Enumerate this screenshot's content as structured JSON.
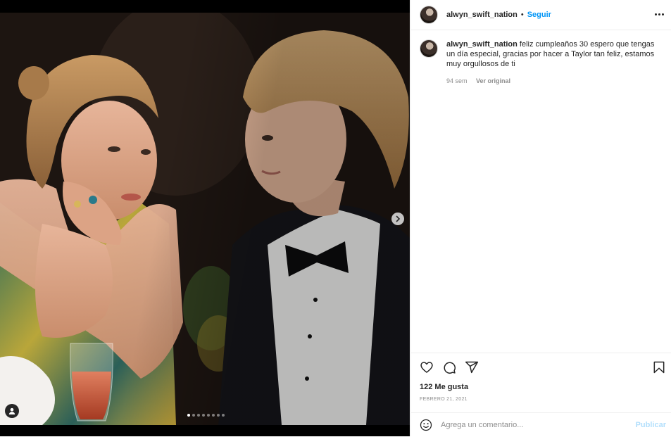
{
  "post": {
    "username": "alwyn_swift_nation",
    "separator": "•",
    "follow_label": "Seguir",
    "caption_user": "alwyn_swift_nation",
    "caption_text": " feliz cumpleaños 30 espero que tengas un día especial, gracias por hacer a Taylor tan feliz, estamos muy orgullosos de ti",
    "age": "94 sem",
    "see_original": "Ver original",
    "likes": "122 Me gusta",
    "date": "FEBRERO 21, 2021"
  },
  "media": {
    "carousel_count": 8,
    "carousel_active_index": 0
  },
  "comment": {
    "placeholder": "Agrega un comentario...",
    "publish_label": "Publicar"
  },
  "icons": {
    "more": "more-options-icon",
    "next": "chevron-right-icon",
    "tag": "user-tag-icon",
    "like": "heart-icon",
    "comment": "comment-bubble-icon",
    "share": "paper-plane-icon",
    "save": "bookmark-icon",
    "emoji": "smiley-icon"
  },
  "colors": {
    "accent": "#0095f6",
    "publish_disabled": "#b2dffc",
    "muted": "#8e8e8e",
    "text": "#262626"
  }
}
